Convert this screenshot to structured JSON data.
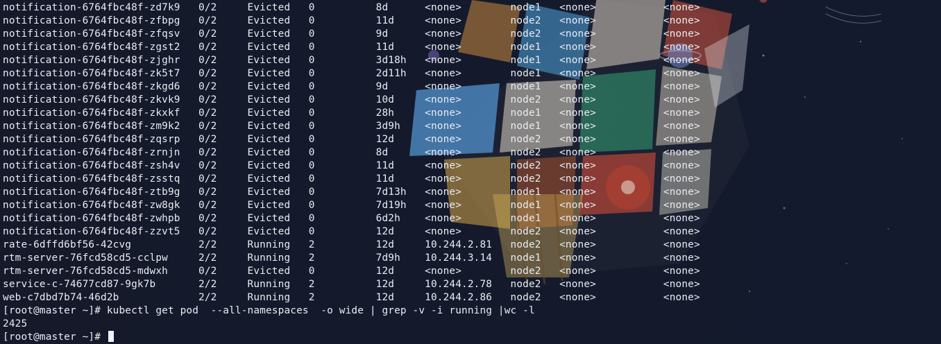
{
  "terminal": {
    "output_lines": [
      "notification-6764fbc48f-zd7k9   0/2     Evicted   0          8d      <none>        node1   <none>           <none>",
      "notification-6764fbc48f-zfbpg   0/2     Evicted   0          11d     <none>        node2   <none>           <none>",
      "notification-6764fbc48f-zfqsv   0/2     Evicted   0          9d      <none>        node2   <none>           <none>",
      "notification-6764fbc48f-zgst2   0/2     Evicted   0          11d     <none>        node1   <none>           <none>",
      "notification-6764fbc48f-zjghr   0/2     Evicted   0          3d18h   <none>        node1   <none>           <none>",
      "notification-6764fbc48f-zk5t7   0/2     Evicted   0          2d11h   <none>        node1   <none>           <none>",
      "notification-6764fbc48f-zkgd6   0/2     Evicted   0          9d      <none>        node1   <none>           <none>",
      "notification-6764fbc48f-zkvk9   0/2     Evicted   0          10d     <none>        node2   <none>           <none>",
      "notification-6764fbc48f-zkxkf   0/2     Evicted   0          28h     <none>        node1   <none>           <none>",
      "notification-6764fbc48f-zm9k2   0/2     Evicted   0          3d9h    <none>        node1   <none>           <none>",
      "notification-6764fbc48f-zqsrp   0/2     Evicted   0          12d     <none>        node2   <none>           <none>",
      "notification-6764fbc48f-zrnjn   0/2     Evicted   0          8d      <none>        node2   <none>           <none>",
      "notification-6764fbc48f-zsh4v   0/2     Evicted   0          11d     <none>        node2   <none>           <none>",
      "notification-6764fbc48f-zsstq   0/2     Evicted   0          11d     <none>        node2   <none>           <none>",
      "notification-6764fbc48f-ztb9g   0/2     Evicted   0          7d13h   <none>        node1   <none>           <none>",
      "notification-6764fbc48f-zw8gk   0/2     Evicted   0          7d19h   <none>        node1   <none>           <none>",
      "notification-6764fbc48f-zwhpb   0/2     Evicted   0          6d2h    <none>        node1   <none>           <none>",
      "notification-6764fbc48f-zzvt5   0/2     Evicted   0          12d     <none>        node2   <none>           <none>",
      "rate-6dffd6bf56-42cvg           2/2     Running   2          12d     10.244.2.81   node2   <none>           <none>",
      "rtm-server-76fcd58cd5-cclpw     2/2     Running   2          7d9h    10.244.3.14   node1   <none>           <none>",
      "rtm-server-76fcd58cd5-mdwxh     0/2     Evicted   0          12d     <none>        node2   <none>           <none>",
      "service-c-74677cd87-9gk7b       2/2     Running   2          12d     10.244.2.78   node2   <none>           <none>",
      "web-c7dbd7b74-46d2b             2/2     Running   2          12d     10.244.2.86   node2   <none>           <none>"
    ],
    "command_line": "[root@master ~]# kubectl get pod  --all-namespaces  -o wide | grep -v -i running |wc -l",
    "command_result": "2425",
    "current_prompt": "[root@master ~]# "
  },
  "colors": {
    "background": "#131a2b",
    "text": "#e9ecf2"
  }
}
